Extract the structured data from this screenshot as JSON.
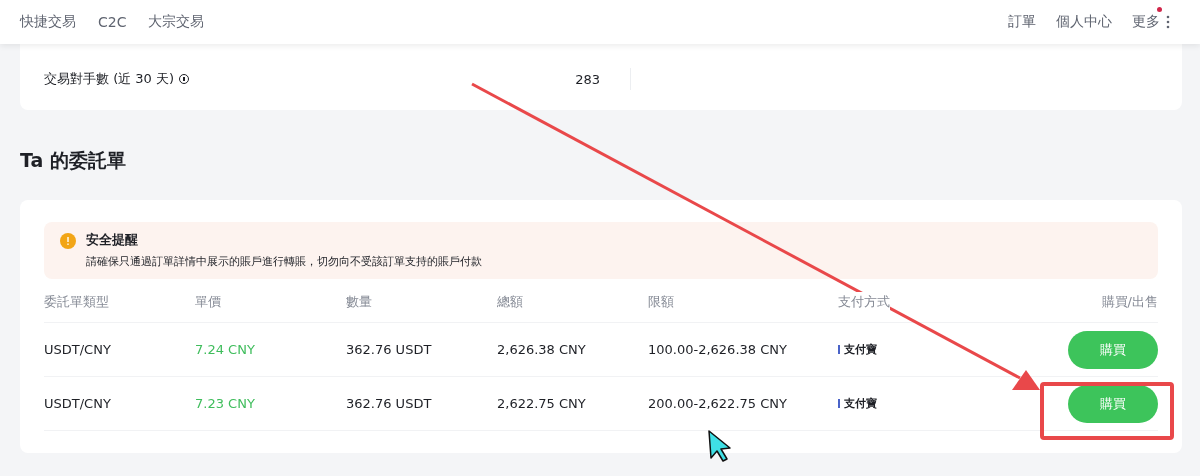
{
  "nav": {
    "left": [
      {
        "label": "快捷交易"
      },
      {
        "label": "C2C"
      },
      {
        "label": "大宗交易"
      }
    ],
    "right": [
      {
        "label": "訂單"
      },
      {
        "label": "個人中心"
      },
      {
        "label": "更多",
        "notification": true,
        "kind": "menu"
      }
    ]
  },
  "stats": [
    {
      "kind": "info",
      "label": "交易對手數 (近 30 天)",
      "value": "283"
    }
  ],
  "section_title": "Ta 的委託單",
  "alert": {
    "title": "安全提醒",
    "message": "請確保只通過訂單詳情中展示的賬戶進行轉賬，切勿向不受該訂單支持的賬戶付款"
  },
  "table": {
    "columns": [
      "委託單類型",
      "單價",
      "數量",
      "總額",
      "限額",
      "支付方式",
      "購買/出售"
    ],
    "rows": [
      {
        "type": "USDT/CNY",
        "price": "7.24 CNY",
        "quantity": "362.76 USDT",
        "total": "2,626.38 CNY",
        "limit": "100.00-2,626.38 CNY",
        "payment": "支付寶",
        "action": "購買"
      },
      {
        "type": "USDT/CNY",
        "price": "7.23 CNY",
        "quantity": "362.76 USDT",
        "total": "2,622.75 CNY",
        "limit": "200.00-2,622.75 CNY",
        "payment": "支付寶",
        "action": "購買"
      }
    ]
  }
}
